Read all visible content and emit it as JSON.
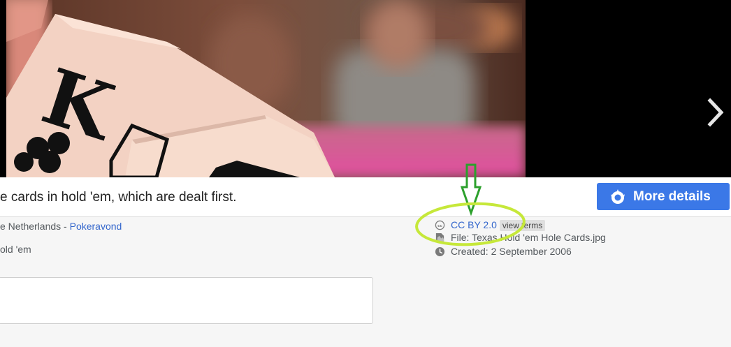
{
  "caption": "e cards in hold 'em, which are dealt first.",
  "more_details_label": "More details",
  "author_prefix": "e Netherlands - ",
  "author_link": "Pokeravond",
  "category": "old 'em",
  "license_label": "CC BY 2.0",
  "view_terms_label": "view terms",
  "file_line": "File: Texas Hold 'em Hole Cards.jpg",
  "created_line": "Created: 2 September 2006",
  "icons": {
    "next": "chevron-right-icon",
    "more_details": "mediaviewer-icon",
    "license": "cc-icon",
    "file": "file-icon",
    "created": "clock-icon",
    "annotation_arrow": "arrow-down-icon"
  },
  "colors": {
    "button": "#3b78e7",
    "link": "#3366cc",
    "annotation_green": "#2ca02c",
    "annotation_yellow": "#c6e83a"
  }
}
